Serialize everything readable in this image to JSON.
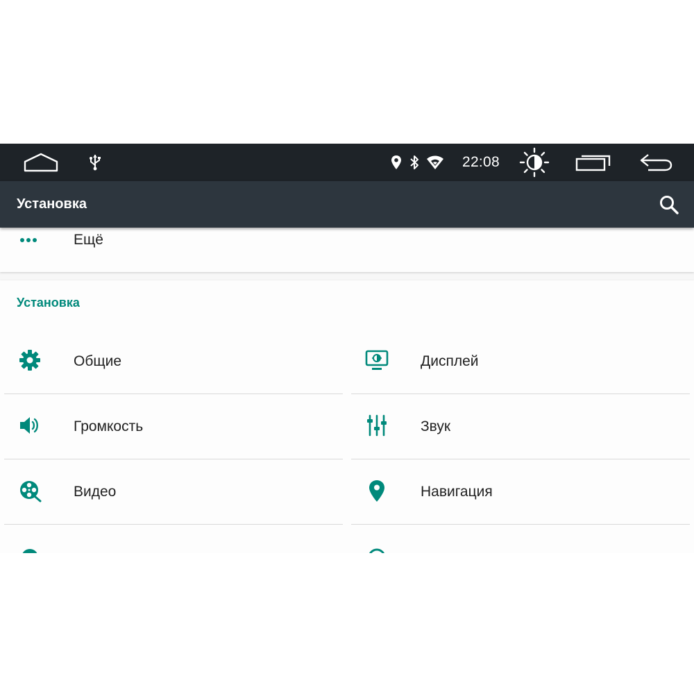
{
  "status_bar": {
    "time": "22:08",
    "icons": [
      "home-outline-icon",
      "usb-icon",
      "location-icon",
      "bluetooth-icon",
      "wifi-icon",
      "brightness-icon",
      "recent-apps-icon",
      "back-arrow-icon"
    ]
  },
  "app_bar": {
    "title": "Установка",
    "search_icon": "search-icon"
  },
  "more": {
    "label": "Ещё",
    "icon": "more-dots-icon"
  },
  "settings": {
    "header": "Установка",
    "accent_color": "#00897b",
    "items": [
      {
        "label": "Общие",
        "icon": "gear-icon"
      },
      {
        "label": "Дисплей",
        "icon": "display-icon"
      },
      {
        "label": "Громкость",
        "icon": "volume-icon"
      },
      {
        "label": "Звук",
        "icon": "equalizer-icon"
      },
      {
        "label": "Видео",
        "icon": "video-reel-icon"
      },
      {
        "label": "Навигация",
        "icon": "map-pin-icon"
      }
    ]
  }
}
